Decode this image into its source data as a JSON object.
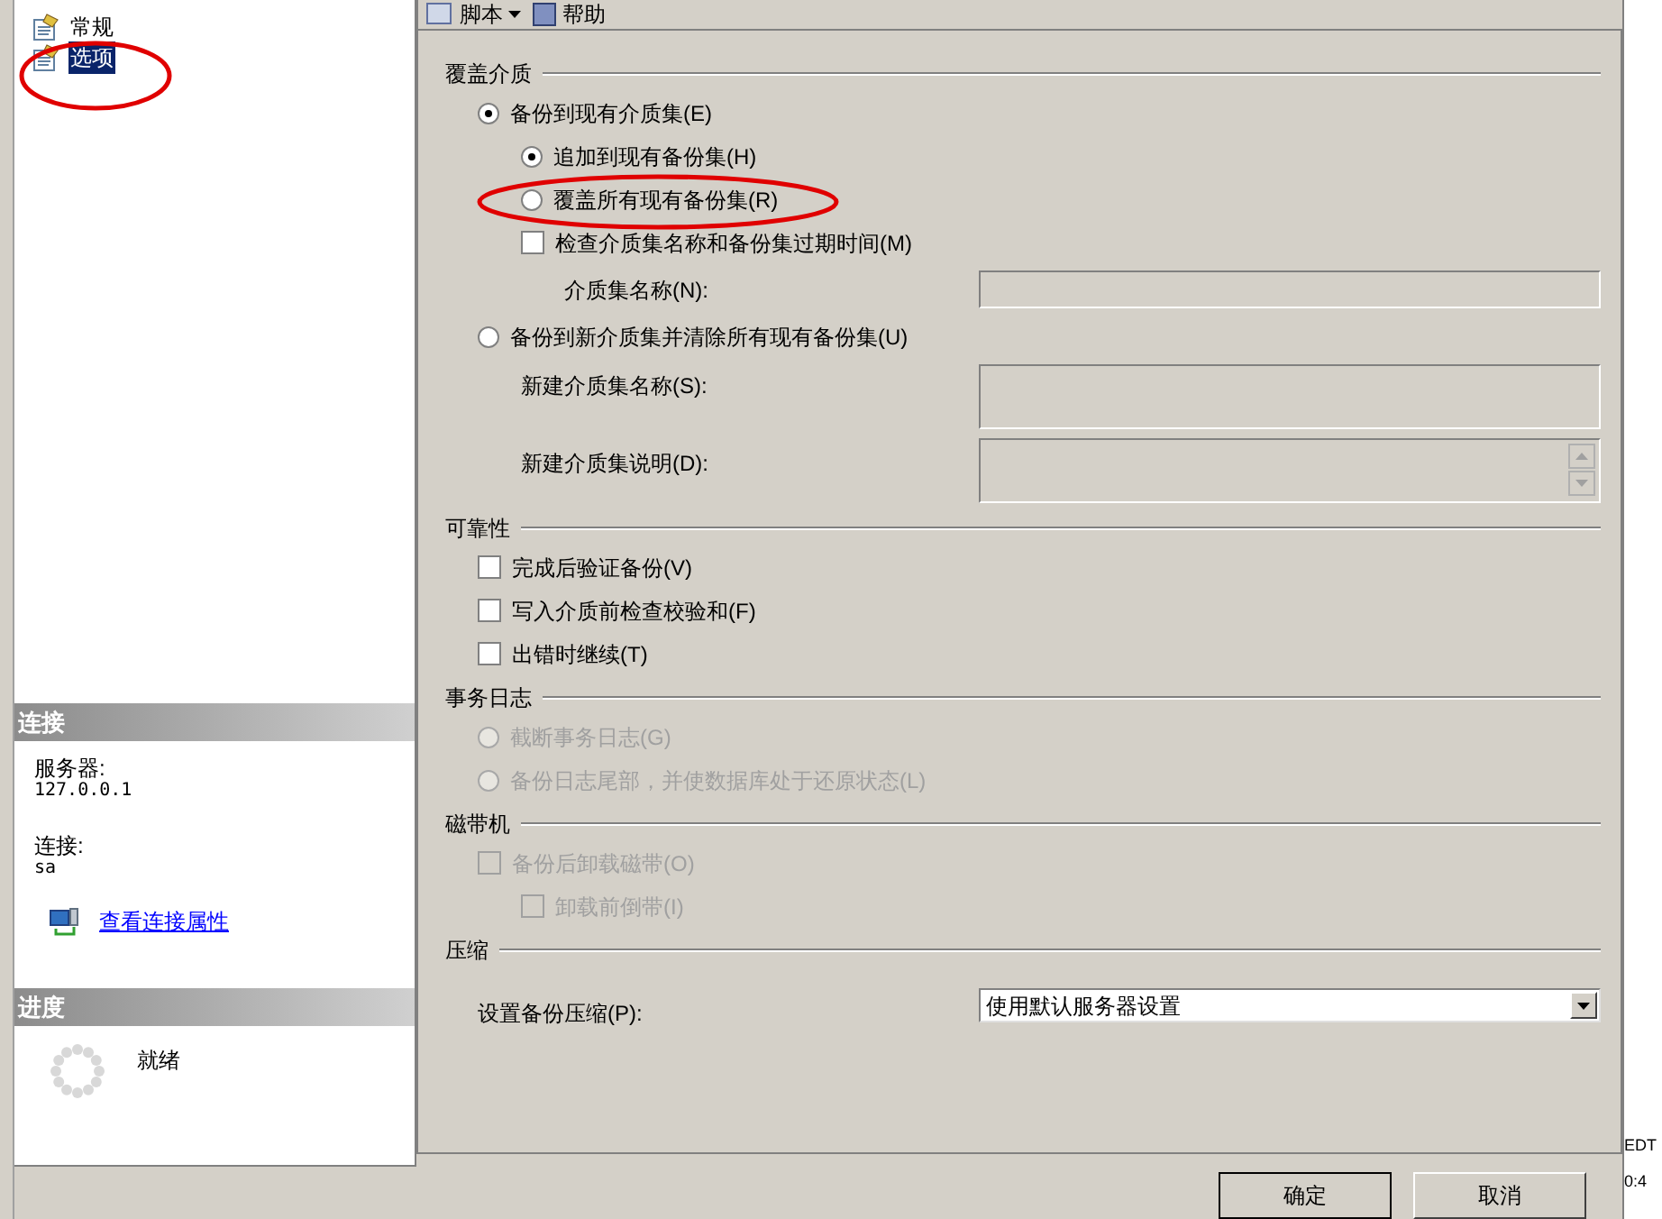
{
  "sidebar": {
    "pages": [
      {
        "label": "常规",
        "selected": false
      },
      {
        "label": "选项",
        "selected": true
      }
    ],
    "connection": {
      "title": "连接",
      "server_label": "服务器:",
      "server": "127.0.0.1",
      "login_label": "连接:",
      "login": "sa",
      "link": "查看连接属性"
    },
    "progress": {
      "title": "进度",
      "status": "就绪"
    }
  },
  "toolbar": [
    {
      "label": "脚本",
      "kind": "dropdown"
    },
    {
      "label": "帮助",
      "kind": "button"
    }
  ],
  "sections": [
    {
      "title": "覆盖介质",
      "items": [
        {
          "kind": "radio",
          "label": "备份到现有介质集(E)",
          "selected": true,
          "disabled": false,
          "children": [
            {
              "kind": "radio",
              "label": "追加到现有备份集(H)",
              "selected": true,
              "disabled": false
            },
            {
              "kind": "radio",
              "label": "覆盖所有现有备份集(R)",
              "selected": false,
              "disabled": false
            },
            {
              "kind": "checkbox",
              "label": "检查介质集名称和备份集过期时间(M)",
              "checked": false,
              "disabled": false,
              "children": [
                {
                  "kind": "field",
                  "label": "介质集名称(N):"
                }
              ]
            }
          ]
        },
        {
          "kind": "radio",
          "label": "备份到新介质集并清除所有现有备份集(U)",
          "selected": false,
          "disabled": false,
          "children": [
            {
              "kind": "large_field",
              "label": "新建介质集名称(S):"
            },
            {
              "kind": "textarea",
              "label": "新建介质集说明(D):"
            }
          ]
        }
      ]
    },
    {
      "title": "可靠性",
      "items": [
        {
          "kind": "checkbox",
          "label": "完成后验证备份(V)",
          "checked": false,
          "disabled": false
        },
        {
          "kind": "checkbox",
          "label": "写入介质前检查校验和(F)",
          "checked": false,
          "disabled": false
        },
        {
          "kind": "checkbox",
          "label": "出错时继续(T)",
          "checked": false,
          "disabled": false
        }
      ]
    },
    {
      "title": "事务日志",
      "items": [
        {
          "kind": "radio",
          "label": "截断事务日志(G)",
          "selected": false,
          "disabled": true
        },
        {
          "kind": "radio",
          "label": "备份日志尾部，并使数据库处于还原状态(L)",
          "selected": false,
          "disabled": true
        }
      ]
    },
    {
      "title": "磁带机",
      "items": [
        {
          "kind": "checkbox",
          "label": "备份后卸载磁带(O)",
          "checked": false,
          "disabled": true,
          "children": [
            {
              "kind": "checkbox",
              "label": "卸载前倒带(I)",
              "checked": false,
              "disabled": true
            }
          ]
        }
      ]
    },
    {
      "title": "压缩",
      "items": [
        {
          "kind": "select",
          "label": "设置备份压缩(P):",
          "value": "使用默认服务器设置"
        }
      ]
    }
  ],
  "buttons": [
    "确定",
    "取消"
  ],
  "background_window": {
    "fragments": [
      "EDT",
      "0:4"
    ]
  }
}
